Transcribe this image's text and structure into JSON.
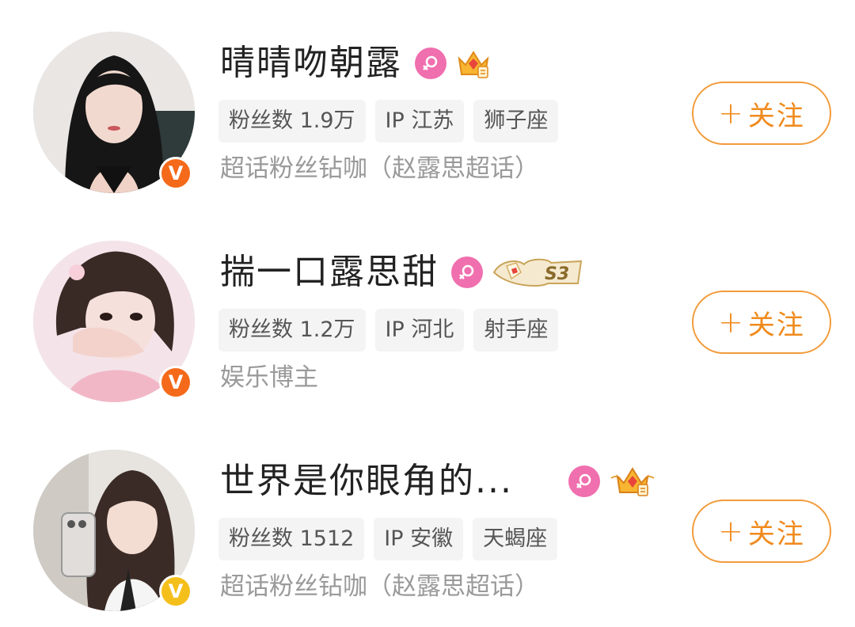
{
  "colors": {
    "accent_orange": "#f08a1c",
    "verify_orange": "#f46a1a",
    "verify_gold": "#f5bf1b",
    "gender_pink": "#f06fae",
    "tag_bg": "#f4f4f4"
  },
  "users": [
    {
      "name": "晴晴吻朝露",
      "gender_icon": "female-icon",
      "badge_icon": "crown-icon",
      "verify_icon": "verified-v-icon",
      "tags": [
        "粉丝数 1.9万",
        "IP 江苏",
        "狮子座"
      ],
      "subtitle": "超话粉丝钻咖（赵露思超话）",
      "follow_plus": "+",
      "follow_label": "关注"
    },
    {
      "name": "揣一口露思甜",
      "gender_icon": "female-icon",
      "badge_icon": "s3-rank-badge",
      "badge_text": "S3",
      "verify_icon": "verified-v-icon",
      "tags": [
        "粉丝数 1.2万",
        "IP 河北",
        "射手座"
      ],
      "subtitle": "娱乐博主",
      "follow_plus": "+",
      "follow_label": "关注"
    },
    {
      "name": "世界是你眼角的...",
      "gender_icon": "female-icon",
      "badge_icon": "crown-icon",
      "verify_icon": "verified-v-icon",
      "tags": [
        "粉丝数 1512",
        "IP 安徽",
        "天蝎座"
      ],
      "subtitle": "超话粉丝钻咖（赵露思超话）",
      "follow_plus": "+",
      "follow_label": "关注"
    }
  ]
}
